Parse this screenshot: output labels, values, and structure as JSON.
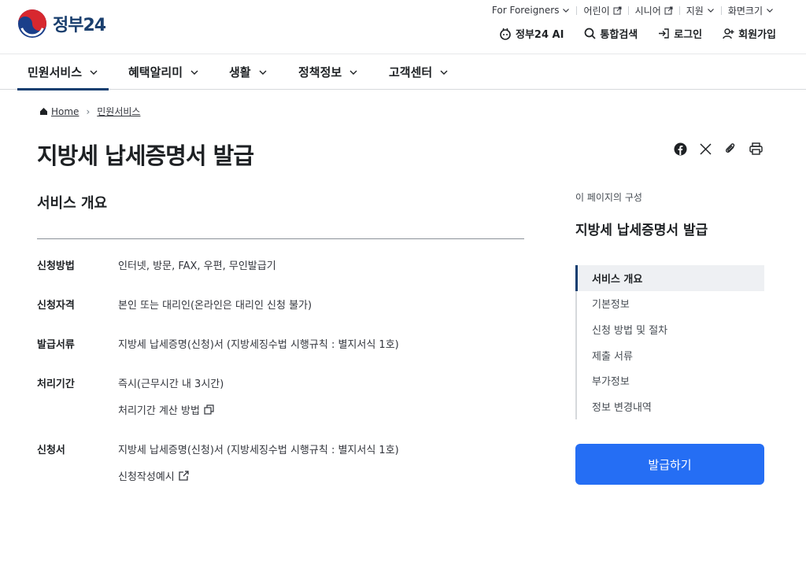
{
  "header": {
    "logo_text": "정부24",
    "utility": [
      {
        "label": "For Foreigners",
        "icon": "chevron-down-icon"
      },
      {
        "label": "어린이",
        "icon": "external-link-icon"
      },
      {
        "label": "시니어",
        "icon": "external-link-icon"
      },
      {
        "label": "지원",
        "icon": "chevron-down-icon"
      },
      {
        "label": "화면크기",
        "icon": "chevron-down-icon"
      }
    ],
    "actions": [
      {
        "label": "정부24 AI",
        "icon": "ai-assistant-icon"
      },
      {
        "label": "통합검색",
        "icon": "search-icon"
      },
      {
        "label": "로그인",
        "icon": "login-icon"
      },
      {
        "label": "회원가입",
        "icon": "user-plus-icon"
      }
    ]
  },
  "nav": {
    "items": [
      {
        "label": "민원서비스",
        "active": true
      },
      {
        "label": "혜택알리미",
        "active": false
      },
      {
        "label": "생활",
        "active": false
      },
      {
        "label": "정책정보",
        "active": false
      },
      {
        "label": "고객센터",
        "active": false
      }
    ]
  },
  "breadcrumb": {
    "home": "Home",
    "current": "민원서비스"
  },
  "page": {
    "title": "지방세 납세증명서 발급",
    "share_icons": [
      "facebook-icon",
      "x-icon",
      "link-clip-icon",
      "print-icon"
    ],
    "section_title": "서비스 개요",
    "rows": [
      {
        "label": "신청방법",
        "value": "인터넷, 방문, FAX, 우편, 무인발급기"
      },
      {
        "label": "신청자격",
        "value": "본인 또는 대리인(온라인은 대리인 신청 불가)"
      },
      {
        "label": "발급서류",
        "value": "지방세 납세증명(신청)서 (지방세징수법 시행규칙 : 별지서식 1호)"
      },
      {
        "label": "처리기간",
        "value": "즉시(근무시간 내 3시간)",
        "link": "처리기간 계산 방법"
      },
      {
        "label": "신청서",
        "value": "지방세 납세증명(신청)서 (지방세징수법 시행규칙 : 별지서식 1호)",
        "link": "신청작성예시"
      }
    ]
  },
  "sidebar": {
    "caption": "이 페이지의 구성",
    "title": "지방세 납세증명서 발급",
    "toc": [
      {
        "label": "서비스 개요",
        "active": true
      },
      {
        "label": "기본정보",
        "active": false
      },
      {
        "label": "신청 방법 및 절차",
        "active": false
      },
      {
        "label": "제출 서류",
        "active": false
      },
      {
        "label": "부가정보",
        "active": false
      },
      {
        "label": "정보 변경내역",
        "active": false
      }
    ],
    "issue_button": "발급하기"
  },
  "colors": {
    "primary": "#256ef4",
    "navy": "#123e70",
    "text": "#1e2124"
  }
}
